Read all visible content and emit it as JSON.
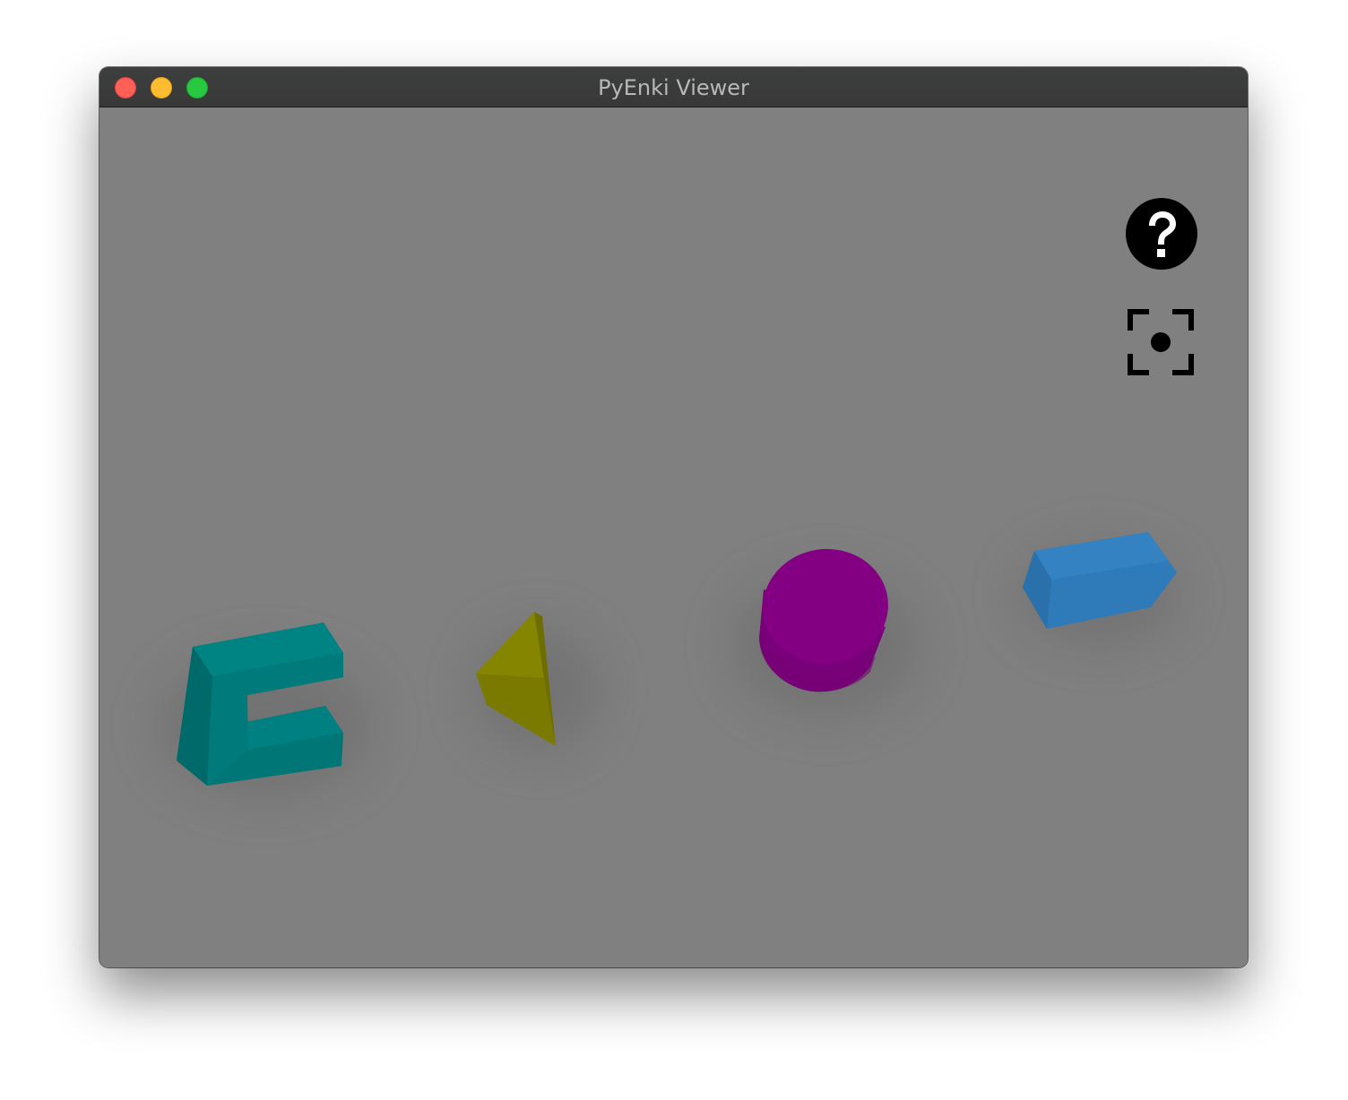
{
  "window": {
    "title": "PyEnki Viewer"
  },
  "controls": {
    "help_icon": "question-mark-circle-icon",
    "focus_icon": "center-focus-icon"
  },
  "scene": {
    "background_color": "#808080",
    "objects": [
      {
        "name": "c-shape",
        "color": "#008080"
      },
      {
        "name": "triangle",
        "color": "#808000"
      },
      {
        "name": "cylinder",
        "color": "#800080"
      },
      {
        "name": "box",
        "color": "#3080c0"
      }
    ]
  }
}
